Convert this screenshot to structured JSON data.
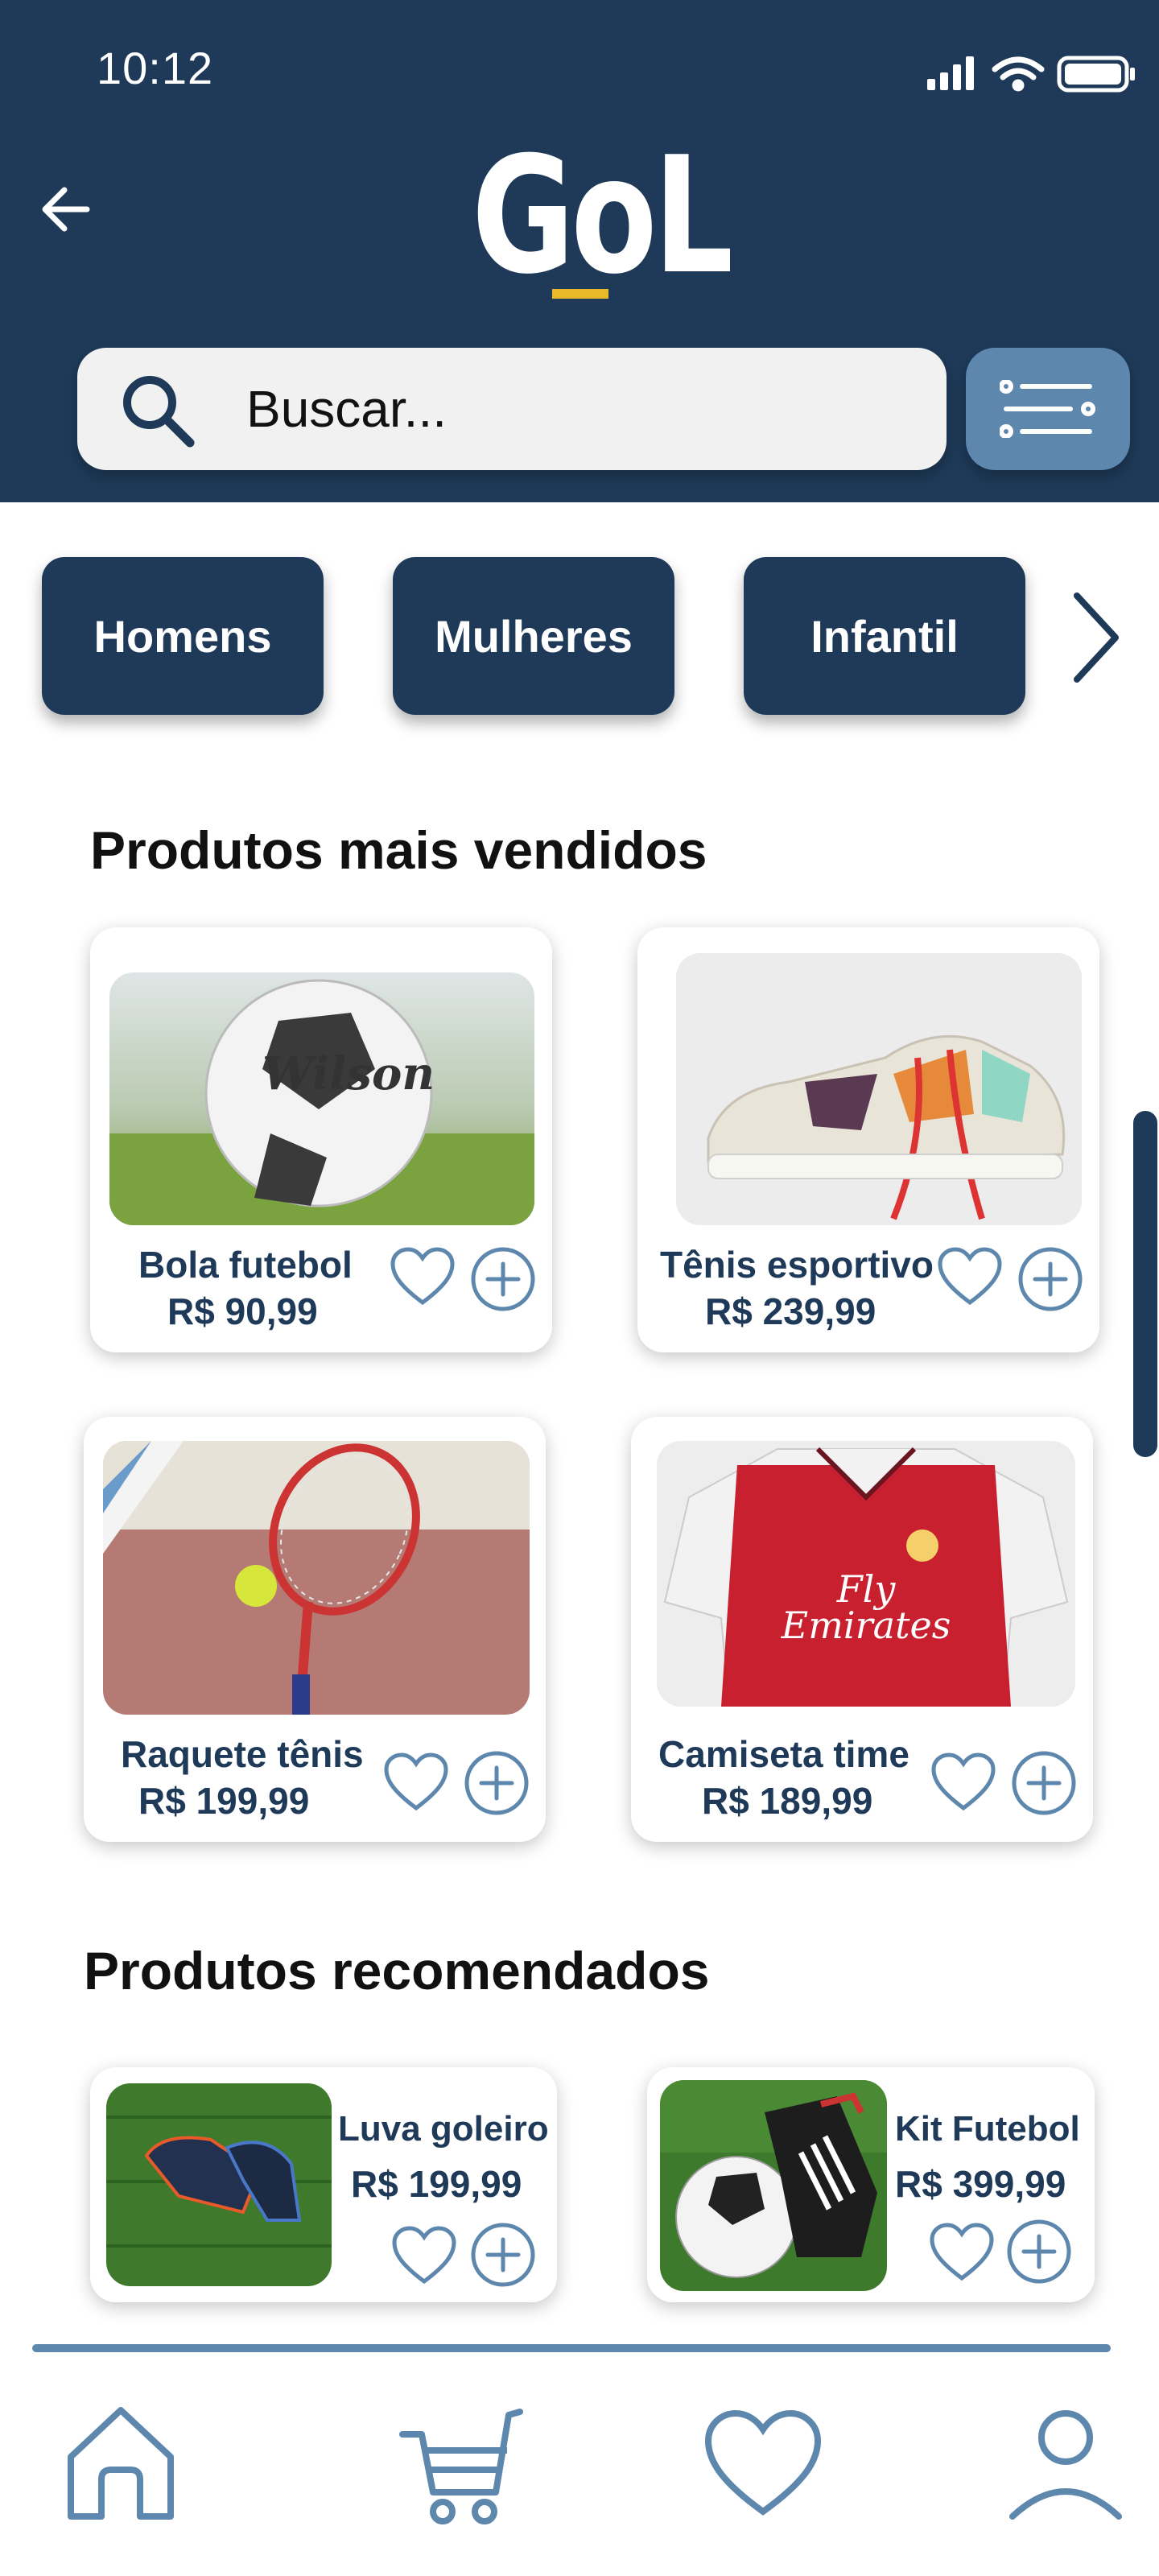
{
  "status_bar": {
    "time": "10:12"
  },
  "header": {
    "logo_text": "GoL"
  },
  "search": {
    "placeholder": "Buscar..."
  },
  "categories": [
    {
      "label": "Homens"
    },
    {
      "label": "Mulheres"
    },
    {
      "label": "Infantil"
    }
  ],
  "best_sellers": {
    "title": "Produtos mais vendidos",
    "items": [
      {
        "name": "Bola futebol",
        "price": "R$ 90,99"
      },
      {
        "name": "Tênis esportivo",
        "price": "R$ 239,99"
      },
      {
        "name": "Raquete tênis",
        "price": "R$ 199,99"
      },
      {
        "name": "Camiseta time",
        "price": "R$ 189,99"
      }
    ]
  },
  "recommended": {
    "title": "Produtos recomendados",
    "items": [
      {
        "name": "Luva goleiro",
        "price": "R$ 199,99"
      },
      {
        "name": "Kit Futebol",
        "price": "R$ 399,99"
      }
    ]
  },
  "nav": {
    "items": [
      "home-icon",
      "cart-icon",
      "heart-icon",
      "profile-icon"
    ]
  },
  "colors": {
    "primary": "#1e3a58",
    "accent": "#5d87ad",
    "logo_accent": "#e8b92b"
  }
}
